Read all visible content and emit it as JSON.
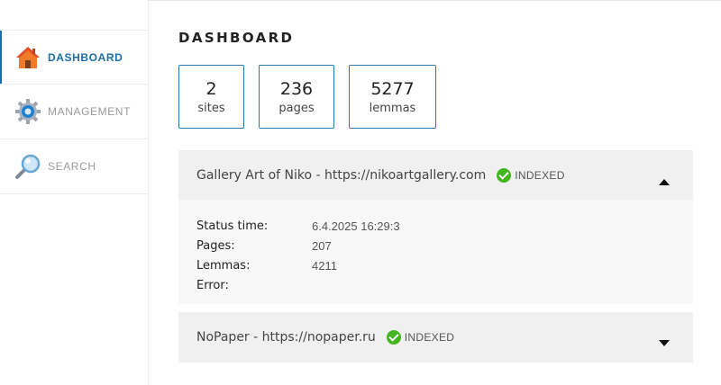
{
  "sidebar": {
    "items": [
      {
        "label": "DASHBOARD",
        "icon": "home-icon",
        "active": true
      },
      {
        "label": "MANAGEMENT",
        "icon": "gear-icon",
        "active": false
      },
      {
        "label": "SEARCH",
        "icon": "magnifier-icon",
        "active": false
      }
    ]
  },
  "main": {
    "title": "DASHBOARD",
    "stats": [
      {
        "value": "2",
        "label": "sites"
      },
      {
        "value": "236",
        "label": "pages"
      },
      {
        "value": "5277",
        "label": "lemmas"
      }
    ],
    "sites": [
      {
        "name": "Gallery Art of Niko - https://nikoartgallery.com",
        "status": "INDEXED",
        "expanded": true,
        "details": [
          {
            "label": "Status time:",
            "value": "6.4.2025 16:29:3"
          },
          {
            "label": "Pages:",
            "value": "207"
          },
          {
            "label": "Lemmas:",
            "value": "4211"
          },
          {
            "label": "Error:",
            "value": ""
          }
        ]
      },
      {
        "name": "NoPaper - https://nopaper.ru",
        "status": "INDEXED",
        "expanded": false
      }
    ]
  },
  "colors": {
    "accent": "#1a6ea6",
    "indexed": "#43b51f",
    "panel": "#f0f0f0"
  }
}
